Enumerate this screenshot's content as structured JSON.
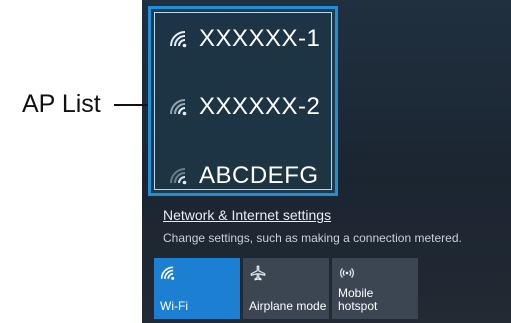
{
  "ap_list": {
    "label": "AP List",
    "items": [
      {
        "name": "XXXXXX-1"
      },
      {
        "name": "XXXXXX-2"
      },
      {
        "name": "ABCDEFG"
      }
    ]
  },
  "network": {
    "settings_link": "Network & Internet settings",
    "description": "Change settings, such as making a connection metered."
  },
  "tiles": [
    {
      "label": "Wi-Fi",
      "icon": "wifi-icon",
      "state": "active"
    },
    {
      "label": "Airplane mode",
      "icon": "airplane-icon",
      "state": "inactive"
    },
    {
      "label": "Mobile hotspot",
      "icon": "hotspot-icon",
      "state": "inactive"
    }
  ],
  "colors": {
    "panel_background": "#1f2a35",
    "highlight_border": "#1f8fd9",
    "active_tile": "#1d7fd1",
    "inactive_tile": "#3b4652"
  }
}
